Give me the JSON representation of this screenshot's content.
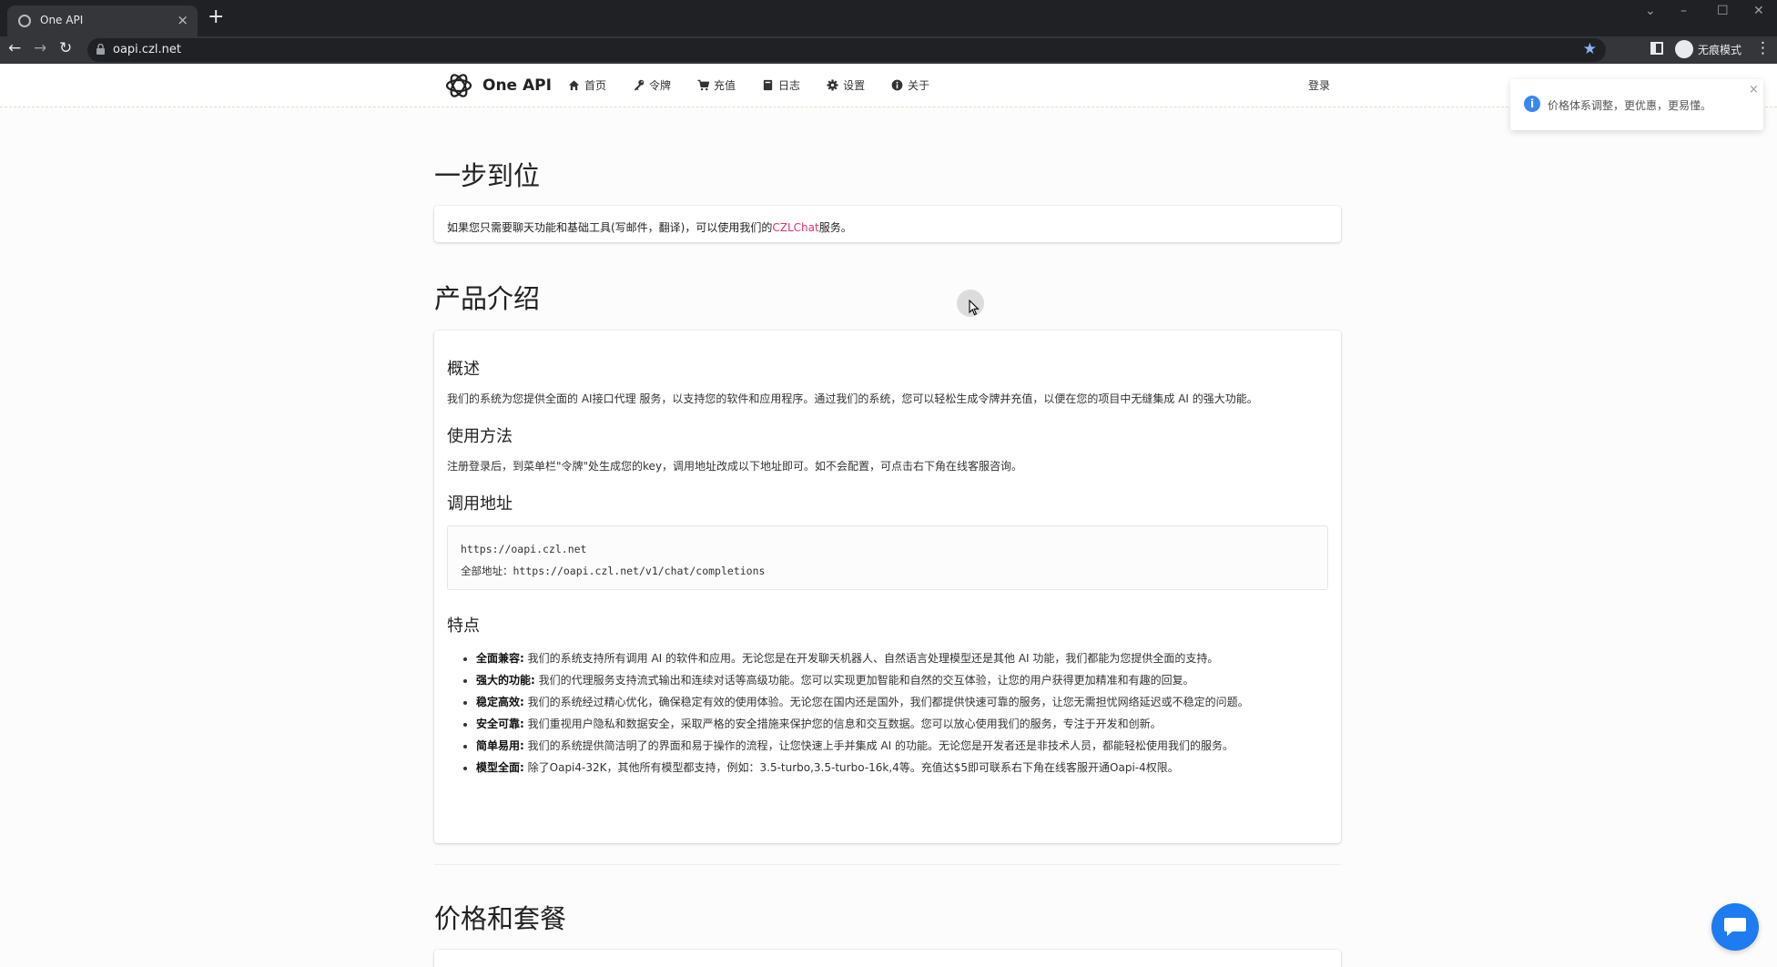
{
  "browser": {
    "tab_title": "One API",
    "tab_close": "×",
    "new_tab": "+",
    "url": "oapi.czl.net",
    "incognito_label": "无痕模式",
    "icons": [
      "chrome-favicon",
      "lock-icon",
      "star-icon",
      "side-panel-icon",
      "incognito-icon",
      "menu-kebab-icon"
    ]
  },
  "header": {
    "brand": "One API",
    "nav": [
      {
        "label": "首页",
        "icon": "home-icon"
      },
      {
        "label": "令牌",
        "icon": "key-icon"
      },
      {
        "label": "充值",
        "icon": "cart-icon"
      },
      {
        "label": "日志",
        "icon": "book-icon"
      },
      {
        "label": "设置",
        "icon": "gear-icon"
      },
      {
        "label": "关于",
        "icon": "info-icon"
      }
    ],
    "login": "登录"
  },
  "intro": {
    "heading": "一步到位",
    "text_before": "如果您只需要聊天功能和基础工具(写邮件，翻译)，可以使用我们的",
    "link": "CZLChat",
    "text_after": "服务。"
  },
  "product": {
    "heading": "产品介绍",
    "overview_title": "概述",
    "overview_text": "我们的系统为您提供全面的 AI接口代理 服务，以支持您的软件和应用程序。通过我们的系统，您可以轻松生成令牌并充值，以便在您的项目中无缝集成 AI 的强大功能。",
    "usage_title": "使用方法",
    "usage_text": "注册登录后，到菜单栏\"令牌\"处生成您的key，调用地址改成以下地址即可。如不会配置，可点击右下角在线客服咨询。",
    "endpoint_title": "调用地址",
    "endpoint_base": "https://oapi.czl.net",
    "endpoint_full_label": "全部地址：",
    "endpoint_full": "https://oapi.czl.net/v1/chat/completions",
    "features_title": "特点",
    "features": [
      {
        "title": "全面兼容:",
        "text": "我们的系统支持所有调用 AI 的软件和应用。无论您是在开发聊天机器人、自然语言处理模型还是其他 AI 功能，我们都能为您提供全面的支持。"
      },
      {
        "title": "强大的功能:",
        "text": "我们的代理服务支持流式输出和连续对话等高级功能。您可以实现更加智能和自然的交互体验，让您的用户获得更加精准和有趣的回复。"
      },
      {
        "title": "稳定高效:",
        "text": "我们的系统经过精心优化，确保稳定有效的使用体验。无论您在国内还是国外，我们都提供快速可靠的服务，让您无需担忧网络延迟或不稳定的问题。"
      },
      {
        "title": "安全可靠:",
        "text": "我们重视用户隐私和数据安全，采取严格的安全措施来保护您的信息和交互数据。您可以放心使用我们的服务，专注于开发和创新。"
      },
      {
        "title": "简单易用:",
        "text": "我们的系统提供简洁明了的界面和易于操作的流程，让您快速上手并集成 AI 的功能。无论您是开发者还是非技术人员，都能轻松使用我们的服务。"
      },
      {
        "title": "模型全面:",
        "text": "除了Oapi4-32K，其他所有模型都支持，例如：3.5-turbo,3.5-turbo-16k,4等。充值达$5即可联系右下角在线客服开通Oapi-4权限。"
      }
    ]
  },
  "pricing": {
    "heading": "价格和套餐"
  },
  "toast": {
    "text": "价格体系调整，更优惠，更易懂。",
    "close": "×",
    "icon": "info-icon"
  },
  "chat_widget": {
    "icon": "chat-bubble-icon"
  },
  "colors": {
    "link": "#e0336b",
    "toast_icon": "#3a86f5",
    "chat_button": "#1e7bf0",
    "browser_dark": "#202124"
  }
}
